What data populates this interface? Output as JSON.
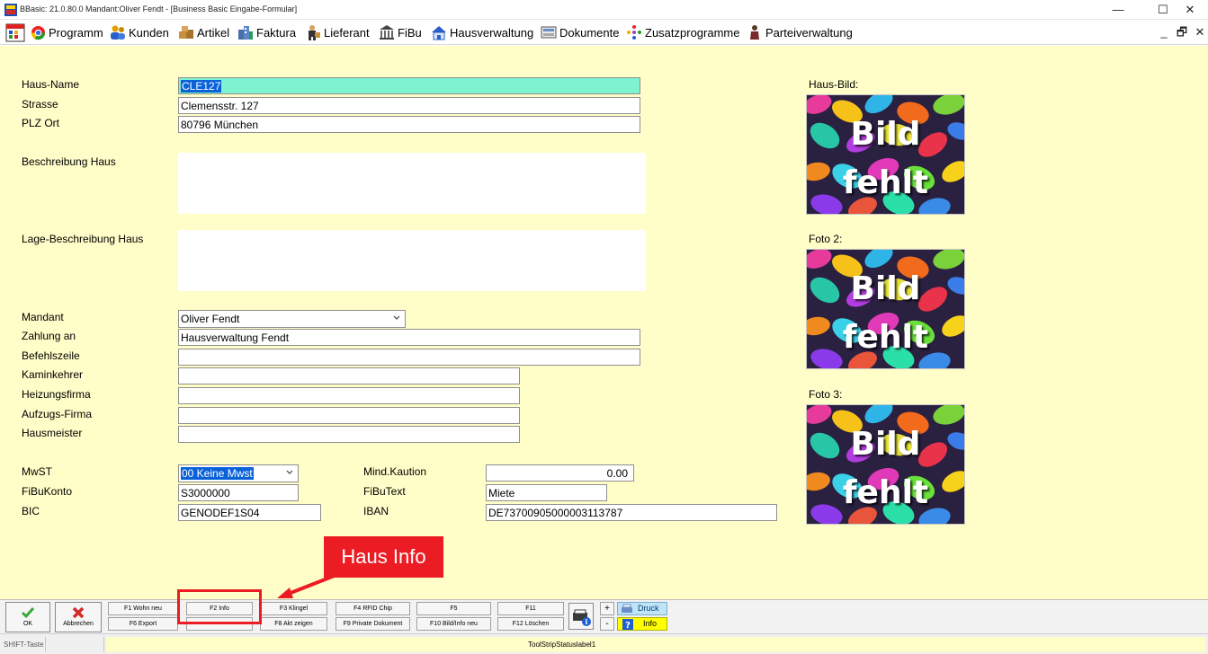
{
  "window": {
    "title": "BBasic: 21.0.80.0 Mandant:Oliver Fendt  - [Business Basic Eingabe-Formular]",
    "minimize": "—",
    "maximize": "☐",
    "close": "✕"
  },
  "menu": {
    "items": [
      {
        "label": "Programm",
        "icon": "chrome-ball-icon"
      },
      {
        "label": "Kunden",
        "icon": "users-icon"
      },
      {
        "label": "Artikel",
        "icon": "boxes-icon"
      },
      {
        "label": "Faktura",
        "icon": "buildings-icon"
      },
      {
        "label": "Lieferant",
        "icon": "delivery-person-icon"
      },
      {
        "label": "FiBu",
        "icon": "bank-icon"
      },
      {
        "label": "Hausverwaltung",
        "icon": "house-icon"
      },
      {
        "label": "Dokumente",
        "icon": "document-tray-icon"
      },
      {
        "label": "Zusatzprogramme",
        "icon": "sparkle-icon"
      },
      {
        "label": "Parteiverwaltung",
        "icon": "person-icon"
      }
    ],
    "mdi_minimize": "_",
    "mdi_restore": "🗗",
    "mdi_close": "✕"
  },
  "form": {
    "haus_name": {
      "label": "Haus-Name",
      "value": "CLE127"
    },
    "strasse": {
      "label": "Strasse",
      "value": "Clemensstr. 127"
    },
    "plz_ort": {
      "label": "PLZ Ort",
      "value": "80796 München"
    },
    "beschreibung": {
      "label": "Beschreibung Haus",
      "value": ""
    },
    "lage": {
      "label": "Lage-Beschreibung Haus",
      "value": ""
    },
    "mandant": {
      "label": "Mandant",
      "value": "Oliver Fendt"
    },
    "zahlung_an": {
      "label": "Zahlung an",
      "value": "Hausverwaltung Fendt"
    },
    "befehlszeile": {
      "label": "Befehlszeile",
      "value": ""
    },
    "kaminkehrer": {
      "label": "Kaminkehrer",
      "value": ""
    },
    "heizungsfirma": {
      "label": "Heizungsfirma",
      "value": ""
    },
    "aufzugsfirma": {
      "label": "Aufzugs-Firma",
      "value": ""
    },
    "hausmeister": {
      "label": "Hausmeister",
      "value": ""
    },
    "mwst": {
      "label": "MwST",
      "value": "00 Keine Mwst"
    },
    "fibukonto": {
      "label": "FiBuKonto",
      "value": "S3000000"
    },
    "bic": {
      "label": "BIC",
      "value": "GENODEF1S04"
    },
    "kaution": {
      "label": "Mind.Kaution",
      "value": "0.00"
    },
    "fibutext": {
      "label": "FiBuText",
      "value": "Miete"
    },
    "iban": {
      "label": "IBAN",
      "value": "DE73700905000003113787"
    }
  },
  "pictures": [
    {
      "label": "Haus-Bild:",
      "line1": "Bild",
      "line2": "fehlt"
    },
    {
      "label": "Foto 2:",
      "line1": "Bild",
      "line2": "fehlt"
    },
    {
      "label": "Foto 3:",
      "line1": "Bild",
      "line2": "fehlt"
    }
  ],
  "callout": {
    "text": "Haus Info",
    "color": "#ec1c24"
  },
  "toolbar": {
    "ok": "OK",
    "abbrechen": "Abbrechen",
    "f1": "F1 Wohn neu",
    "f2": "F2 Info",
    "f3": "F3 Klingel",
    "f4": "F4 RFID Chip",
    "f5": "F5",
    "f11": "F11",
    "f6": "F6 Export",
    "f8": "F8 Akt zeigen",
    "f9": "F9 Private Dokument",
    "f10": "F10 Bild/Info neu",
    "f12": "F12 Löschen",
    "plus": "+",
    "minus": "-",
    "druck": "Druck",
    "info": "Info"
  },
  "status": {
    "shift": "SHIFT-Taste",
    "label1": "ToolStripStatuslabel1"
  }
}
